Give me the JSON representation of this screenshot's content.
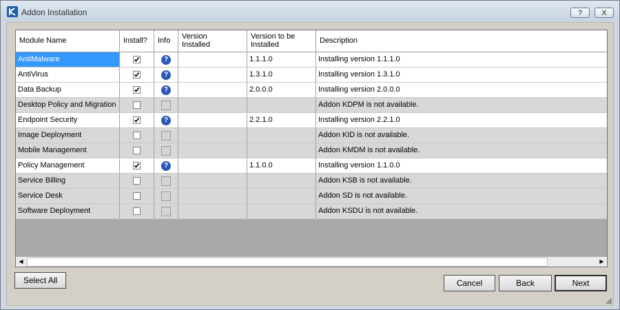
{
  "window": {
    "title": "Addon Installation",
    "help_label": "?",
    "close_label": "X"
  },
  "columns": {
    "module_name": "Module Name",
    "install": "Install?",
    "info": "Info",
    "version_installed_line1": "Version",
    "version_installed_line2": "Installed",
    "version_to_be_line1": "Version to be",
    "version_to_be_line2": "Installed",
    "description": "Description"
  },
  "rows": [
    {
      "name": "AntiMalware",
      "installed": "",
      "to_install": "1.1.1.0",
      "desc": "Installing version 1.1.1.0",
      "checked": true,
      "available": true,
      "selected": true
    },
    {
      "name": "AntiVirus",
      "installed": "",
      "to_install": "1.3.1.0",
      "desc": "Installing version 1.3.1.0",
      "checked": true,
      "available": true,
      "selected": false
    },
    {
      "name": "Data Backup",
      "installed": "",
      "to_install": "2.0.0.0",
      "desc": "Installing version 2.0.0.0",
      "checked": true,
      "available": true,
      "selected": false
    },
    {
      "name": "Desktop Policy and Migration",
      "installed": "",
      "to_install": "",
      "desc": "Addon KDPM is not available.",
      "checked": false,
      "available": false,
      "selected": false
    },
    {
      "name": "Endpoint Security",
      "installed": "",
      "to_install": "2.2.1.0",
      "desc": "Installing version 2.2.1.0",
      "checked": true,
      "available": true,
      "selected": false
    },
    {
      "name": "Image Deployment",
      "installed": "",
      "to_install": "",
      "desc": "Addon KID is not available.",
      "checked": false,
      "available": false,
      "selected": false
    },
    {
      "name": "Mobile Management",
      "installed": "",
      "to_install": "",
      "desc": "Addon KMDM is not available.",
      "checked": false,
      "available": false,
      "selected": false
    },
    {
      "name": "Policy Management",
      "installed": "",
      "to_install": "1.1.0.0",
      "desc": "Installing version 1.1.0.0",
      "checked": true,
      "available": true,
      "selected": false
    },
    {
      "name": "Service Billing",
      "installed": "",
      "to_install": "",
      "desc": "Addon KSB is not available.",
      "checked": false,
      "available": false,
      "selected": false
    },
    {
      "name": "Service Desk",
      "installed": "",
      "to_install": "",
      "desc": "Addon SD is not available.",
      "checked": false,
      "available": false,
      "selected": false
    },
    {
      "name": "Software Deployment",
      "installed": "",
      "to_install": "",
      "desc": "Addon KSDU is not available.",
      "checked": false,
      "available": false,
      "selected": false
    }
  ],
  "info_icon_glyph": "?",
  "buttons": {
    "select_all": "Select All",
    "cancel": "Cancel",
    "back": "Back",
    "next": "Next"
  },
  "scroll": {
    "left": "◀",
    "right": "▶"
  },
  "icons": {
    "info": "info-icon",
    "check": "checkmark-icon",
    "app": "app-logo-icon"
  },
  "colors": {
    "selection": "#3399ff",
    "info_icon": "#2c57b5",
    "unavailable_row": "#d8d8d8"
  }
}
